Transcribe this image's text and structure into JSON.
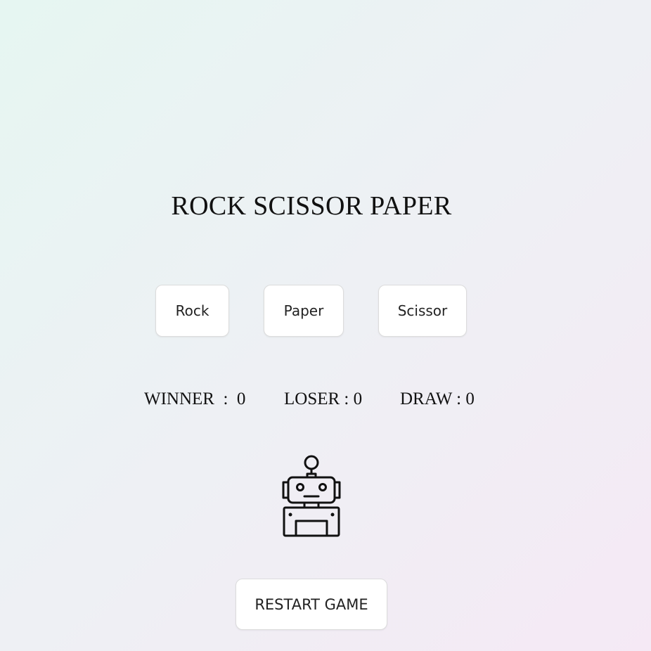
{
  "title": "ROCK SCISSOR PAPER",
  "choices": {
    "rock_label": "Rock",
    "paper_label": "Paper",
    "scissor_label": "Scissor"
  },
  "scoreboard": {
    "winner_text": "WINNER  :  0",
    "loser_text": "LOSER : 0",
    "draw_text": "DRAW : 0",
    "winner": 0,
    "loser": 0,
    "draw": 0
  },
  "opponent_icon": "robot-icon",
  "restart_label": "RESTART GAME",
  "colors": {
    "background_start": "#e6f6f2",
    "background_end": "#f5e9f5",
    "button_bg": "#ffffff",
    "text": "#111111"
  }
}
